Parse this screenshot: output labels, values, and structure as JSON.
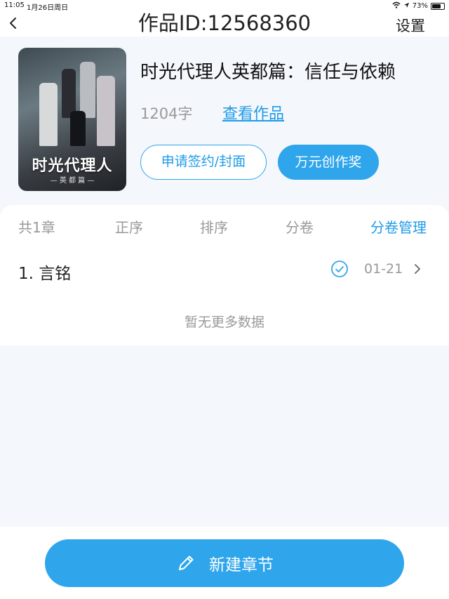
{
  "status_bar": {
    "time": "11:05",
    "date": "1月26日周日",
    "battery": "73%"
  },
  "nav": {
    "title": "作品ID:12568360",
    "settings_label": "设置"
  },
  "work": {
    "title": "时光代理人英都篇：信任与依赖",
    "cover_title": "时光代理人",
    "cover_subtitle": "— 英 都 篇 —",
    "word_count": "1204字",
    "view_link": "查看作品",
    "sign_button": "申请签约/封面",
    "award_button": "万元创作奖"
  },
  "tabs": [
    {
      "label": "共1章",
      "active": false
    },
    {
      "label": "正序",
      "active": false
    },
    {
      "label": "排序",
      "active": false
    },
    {
      "label": "分卷",
      "active": false
    },
    {
      "label": "分卷管理",
      "active": true
    }
  ],
  "chapters": [
    {
      "name": "1. 言铭",
      "date": "01-21"
    }
  ],
  "empty_text": "暂无更多数据",
  "bottom_button": "新建章节",
  "colors": {
    "accent": "#2fa5ec",
    "link": "#1e9be8",
    "muted": "#999999",
    "background": "#f4f7fb"
  }
}
